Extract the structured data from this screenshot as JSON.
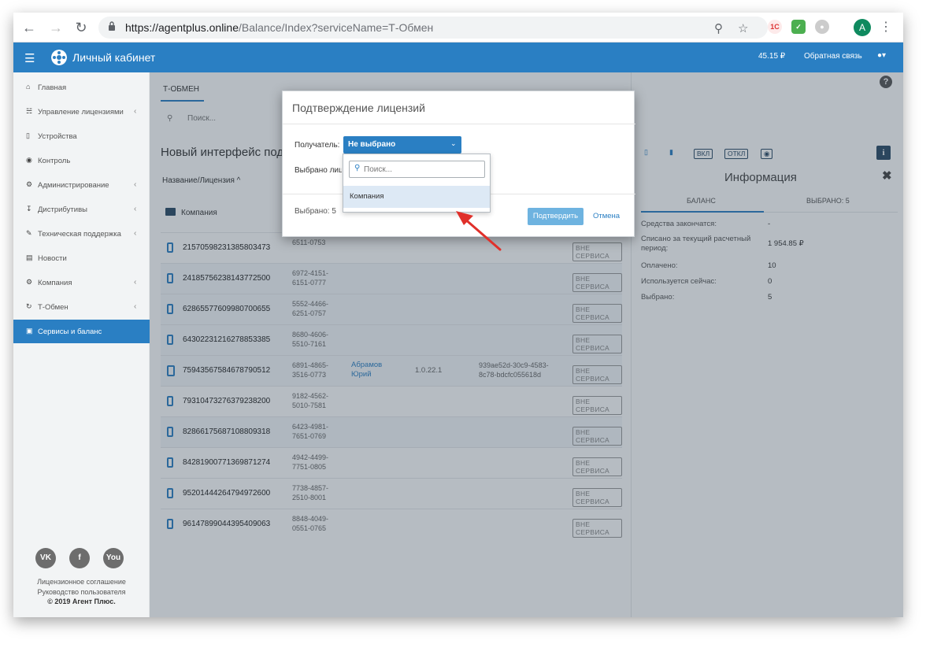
{
  "browser": {
    "url_host": "https://agentplus.online",
    "url_path": "/Balance/Index?serviceName=Т-Обмен",
    "profile_initial": "A",
    "ext_1c": "1С"
  },
  "header": {
    "title": "Личный кабинет",
    "balance": "45.15 ₽",
    "feedback": "Обратная связь"
  },
  "sidebar": {
    "items": [
      {
        "label": "Главная",
        "icon": "home-icon",
        "chevron": false
      },
      {
        "label": "Управление лицензиями",
        "icon": "sitemap-icon",
        "chevron": true
      },
      {
        "label": "Устройства",
        "icon": "mobile-icon",
        "chevron": false
      },
      {
        "label": "Контроль",
        "icon": "globe-icon",
        "chevron": false
      },
      {
        "label": "Администрирование",
        "icon": "gears-icon",
        "chevron": true
      },
      {
        "label": "Дистрибутивы",
        "icon": "download-icon",
        "chevron": true
      },
      {
        "label": "Техническая поддержка",
        "icon": "wrench-icon",
        "chevron": true
      },
      {
        "label": "Новости",
        "icon": "newspaper-icon",
        "chevron": false
      },
      {
        "label": "Компания",
        "icon": "gear-icon",
        "chevron": true
      },
      {
        "label": "Т-Обмен",
        "icon": "refresh-icon",
        "chevron": true
      },
      {
        "label": "Сервисы и баланс",
        "icon": "money-icon",
        "chevron": false,
        "active": true
      }
    ],
    "social": [
      "VK",
      "f",
      "You"
    ],
    "links": [
      "Лицензионное соглашение",
      "Руководство пользователя"
    ],
    "copyright": "© 2019 Агент Плюс."
  },
  "main": {
    "tab": "Т-ОБМЕН",
    "search_placeholder": "Поиск...",
    "section_title": "Новый интерфейс под",
    "column_header": "Название/Лицензия ^",
    "group": "Компания",
    "rows": [
      {
        "license": "21570598231385803473",
        "code": "6511-0753",
        "owner": "",
        "version": "",
        "guid": "",
        "status": "ВНЕ СЕРВИСА",
        "highlight": false,
        "device": "phone"
      },
      {
        "license": "24185756238143772500",
        "code": "6972-4151-\n6151-0777",
        "owner": "",
        "version": "",
        "guid": "",
        "status": "ВНЕ СЕРВИСА",
        "highlight": true,
        "device": "phone"
      },
      {
        "license": "62865577609980700655",
        "code": "5552-4466-\n6251-0757",
        "owner": "",
        "version": "",
        "guid": "",
        "status": "ВНЕ СЕРВИСА",
        "highlight": true,
        "device": "phone"
      },
      {
        "license": "64302231216278853385",
        "code": "8680-4606-\n5510-7161",
        "owner": "",
        "version": "",
        "guid": "",
        "status": "ВНЕ СЕРВИСА",
        "highlight": true,
        "device": "phone"
      },
      {
        "license": "75943567584678790512",
        "code": "6891-4865-\n3516-0773",
        "owner": "Абрамов\nЮрий",
        "version": "1.0.22.1",
        "guid": "939ae52d-30c9-4583-\n8c78-bdcfc055618d",
        "status": "ВНЕ СЕРВИСА",
        "highlight": true,
        "device": "tablet"
      },
      {
        "license": "79310473276379238200",
        "code": "9182-4562-\n5010-7581",
        "owner": "",
        "version": "",
        "guid": "",
        "status": "ВНЕ СЕРВИСА",
        "highlight": false,
        "device": "phone"
      },
      {
        "license": "82866175687108809318",
        "code": "6423-4981-\n7651-0769",
        "owner": "",
        "version": "",
        "guid": "",
        "status": "ВНЕ СЕРВИСА",
        "highlight": true,
        "device": "phone"
      },
      {
        "license": "84281900771369871274",
        "code": "4942-4499-\n7751-0805",
        "owner": "",
        "version": "",
        "guid": "",
        "status": "ВНЕ СЕРВИСА",
        "highlight": false,
        "device": "phone"
      },
      {
        "license": "95201444264794972600",
        "code": "7738-4857-\n2510-8001",
        "owner": "",
        "version": "",
        "guid": "",
        "status": "ВНЕ СЕРВИСА",
        "highlight": false,
        "device": "phone"
      },
      {
        "license": "96147899044395409063",
        "code": "8848-4049-\n0551-0765",
        "owner": "",
        "version": "",
        "guid": "",
        "status": "ВНЕ СЕРВИСА",
        "highlight": false,
        "device": "phone"
      }
    ]
  },
  "info": {
    "toolbar": {
      "on": "ВКЛ",
      "off": "ОТКЛ"
    },
    "title": "Информация",
    "tabs": [
      "БАЛАНС",
      "ВЫБРАНО: 5"
    ],
    "rows": [
      {
        "label": "Средства закончатся:",
        "value": "-"
      },
      {
        "label": "Списано за текущий расчетный период:",
        "value": "1 954.85 ₽"
      },
      {
        "label": "Оплачено:",
        "value": "10"
      },
      {
        "label": "Используется сейчас:",
        "value": "0"
      },
      {
        "label": "Выбрано:",
        "value": "5"
      }
    ]
  },
  "modal": {
    "title": "Подтверждение лицензий",
    "recipient_label": "Получатель:",
    "recipient_value": "Не выбрано",
    "selected_label": "Выбрано лицензий",
    "footer_count": "Выбрано: 5",
    "confirm": "Подтвердить",
    "cancel": "Отмена"
  },
  "dropdown": {
    "search_placeholder": "Поиск...",
    "options": [
      "Компания"
    ]
  },
  "colors": {
    "accent": "#2a7fc3",
    "arrow": "#e0302a"
  }
}
